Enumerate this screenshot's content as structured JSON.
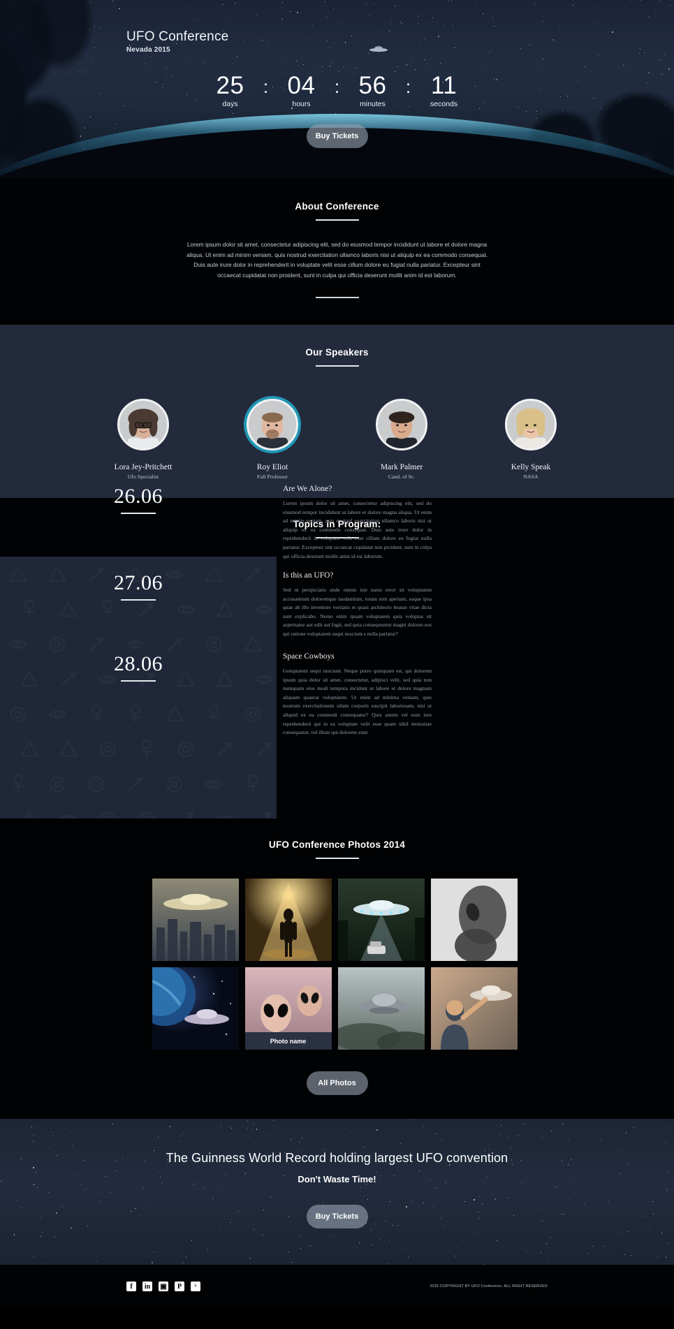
{
  "hero": {
    "title": "UFO Conference",
    "subtitle": "Nevada 2015",
    "countdown": [
      {
        "value": "25",
        "label": "days"
      },
      {
        "value": "04",
        "label": "hours"
      },
      {
        "value": "56",
        "label": "minutes"
      },
      {
        "value": "11",
        "label": "seconds"
      }
    ],
    "separator": ":",
    "cta_label": "Buy Tickets"
  },
  "about": {
    "title": "About Conference",
    "body": "Lorem ipsum dolor sit amet, consectetur adipiscing elit, sed do eiusmod tempor incididunt ut labore et dolore magna aliqua. Ut enim ad minim veniam, quis nostrud exercitation ullamco laboris nisi ut aliquip ex ea commodo consequat. Duis aute irure dolor in reprehenderit in voluptate velit esse cillum dolore eu fugiat nulla pariatur. Excepteur sint occaecat cupidatat non proident, sunt in culpa qui officia deserunt mollit anim id est laborum."
  },
  "speakers": {
    "title": "Our Speakers",
    "accent_color": "#2196b5",
    "items": [
      {
        "name": "Lora Jey-Pritchett",
        "role": "Ufo Specialist",
        "active": false
      },
      {
        "name": "Roy Eliot",
        "role": "Full Professor",
        "active": true
      },
      {
        "name": "Mark Palmer",
        "role": "Cand. of Sc.",
        "active": false
      },
      {
        "name": "Kelly Speak",
        "role": "NASA",
        "active": false
      }
    ]
  },
  "topics": {
    "title": "Topics in Program:",
    "items": [
      {
        "date": "26.06",
        "heading": "Are We Alone?",
        "text": "Lorem ipsum dolor sit amet, consectetur adipiscing elit, sed do eiusmod tempor incididunt ut labore et dolore magna aliqua. Ut enim ad minim veniam, quis nostrud exercitation ullamco laboris nisi ut aliquip ex ea commodo consequat. Duis aute irure dolor in reprehenderit in voluptate velit esse cillum dolore eu fugiat nulla pariatur. Excepteur sint occaecat cupidatat non proident, sunt in culpa qui officia deserunt mollit anim id est laborum."
      },
      {
        "date": "27.06",
        "heading": "Is this an UFO?",
        "text": "Sed ut perspiciatis unde omnis iste natus error sit voluptatem accusantium doloremque laudantium, totam rem aperiam, eaque ipsa quae ab illo inventore veritatis et quasi architecto beatae vitae dicta sunt explicabo. Nemo enim ipsam voluptatem quia voluptas sit aspernatur aut odit aut fugit, sed quia consequuntur magni dolores eos qui ratione voluptatem sequi nesciunt.s nulla pariatur?"
      },
      {
        "date": "28.06",
        "heading": "Space Cowboys",
        "text": "Goluptatem sequi nesciunt. Neque porro quisquam est, qui dolorem ipsum quia dolor sit amet, consectetur, adipisci velit, sed quia non numquam eius modi tempora incidunt ut labore et dolore magnam aliquam quaerat voluptatem. Ut enim ad minima veniam, quis nostrum exercitationem ullam corporis suscipit laboriosam, nisi ut aliquid ex ea commodi consequatur? Quis autem vel eum iure reprehenderit qui in ea voluptate velit esse quam nihil molestiae consequatur, vel illum qui dolorem eum"
      }
    ]
  },
  "photos": {
    "title": "UFO Conference Photos 2014",
    "caption": "Photo name",
    "captioned_index": 5,
    "button_label": "All Photos",
    "items": [
      {
        "alt": "ufo-over-city"
      },
      {
        "alt": "abduction-light-beam"
      },
      {
        "alt": "ufo-over-road-forest"
      },
      {
        "alt": "alien-head-shadow"
      },
      {
        "alt": "ufo-over-planet-space"
      },
      {
        "alt": "alien-grey-closeup"
      },
      {
        "alt": "flying-saucer-clouds"
      },
      {
        "alt": "man-watching-ufo"
      }
    ]
  },
  "cta": {
    "headline": "The Guinness World Record holding largest UFO convention",
    "subline": "Don't Waste Time!",
    "button_label": "Buy Tickets"
  },
  "footer": {
    "socials": [
      {
        "name": "facebook-icon",
        "glyph": "f"
      },
      {
        "name": "linkedin-icon",
        "glyph": "in"
      },
      {
        "name": "instagram-icon",
        "glyph": "▣"
      },
      {
        "name": "pinterest-icon",
        "glyph": "P"
      },
      {
        "name": "twitter-icon",
        "glyph": "ᵛ"
      }
    ],
    "copyright": "2015 COPYRIGHT BY UFO Conference. ALL RIGHT RESERVED"
  }
}
